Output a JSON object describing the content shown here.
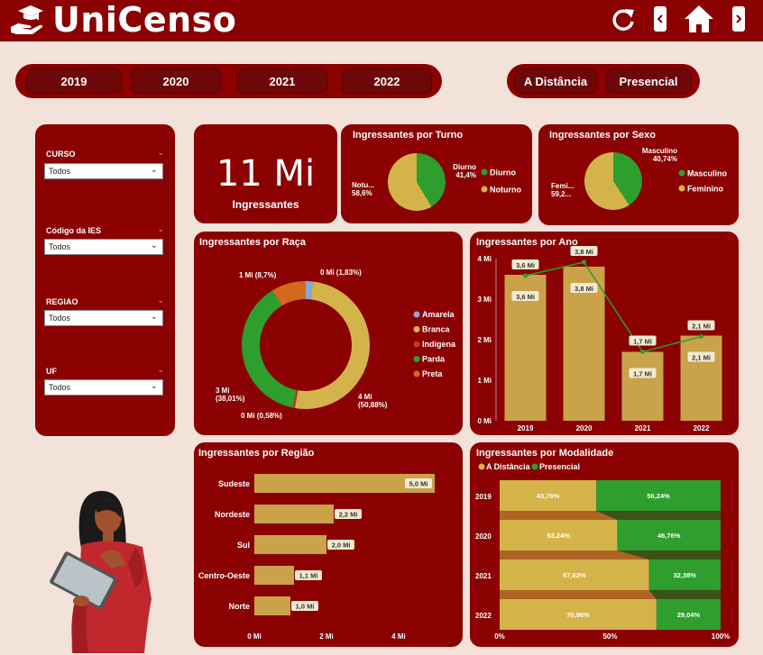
{
  "app": {
    "title": "UniCenso"
  },
  "header": {
    "refresh_icon": "refresh-icon",
    "back_icon": "chevron-left-icon",
    "home_icon": "home-icon",
    "next_icon": "chevron-right-icon"
  },
  "years": [
    "2019",
    "2020",
    "2021",
    "2022"
  ],
  "modalities": [
    "A Distância",
    "Presencial"
  ],
  "filters": [
    {
      "label": "CURSO",
      "value": "Todos"
    },
    {
      "label": "Código da IES",
      "value": "Todos"
    },
    {
      "label": "REGIAO",
      "value": "Todos"
    },
    {
      "label": "UF",
      "value": "Todos"
    }
  ],
  "kpi": {
    "value": "11 Mi",
    "label": "Ingressantes"
  },
  "colors": {
    "bg": "#f2e2da",
    "card": "#8b0000",
    "gold": "#d4b44a",
    "green": "#2e9e2e",
    "orange": "#d2691e",
    "blue": "#87a8d0",
    "red": "#c0392b"
  },
  "chart_data": [
    {
      "id": "turno",
      "type": "pie",
      "title": "Ingressantes por Turno",
      "slices": [
        {
          "name": "Diurno",
          "value": 41.4,
          "label": "Diurno\n41,4%",
          "color": "#2e9e2e"
        },
        {
          "name": "Noturno",
          "value": 58.6,
          "label": "Notu...\n58,6%",
          "color": "#d4b44a"
        }
      ],
      "legend": [
        "Diurno",
        "Noturno"
      ]
    },
    {
      "id": "sexo",
      "type": "pie",
      "title": "Ingressantes por Sexo",
      "slices": [
        {
          "name": "Masculino",
          "value": 40.74,
          "label": "Masculino\n40,74%",
          "color": "#2e9e2e"
        },
        {
          "name": "Feminino",
          "value": 59.26,
          "label": "Femi...\n59,2...",
          "color": "#d4b44a"
        }
      ],
      "legend": [
        "Masculino",
        "Feminino"
      ]
    },
    {
      "id": "raca",
      "type": "pie",
      "title": "Ingressantes por Raça",
      "slices": [
        {
          "name": "Amarela",
          "value": 1.83,
          "label": "0 Mi (1,83%)",
          "color": "#87a8d0"
        },
        {
          "name": "Branca",
          "value": 50.88,
          "label": "4 Mi\n(50,88%)",
          "color": "#d4b44a"
        },
        {
          "name": "Indigena",
          "value": 0.58,
          "label": "0 Mi (0,58%)",
          "color": "#c0392b"
        },
        {
          "name": "Parda",
          "value": 38.01,
          "label": "3 Mi\n(38,01%)",
          "color": "#2e9e2e"
        },
        {
          "name": "Preta",
          "value": 8.7,
          "label": "1 Mi (8,7%)",
          "color": "#d2691e"
        }
      ],
      "legend": [
        "Amarela",
        "Branca",
        "Indigena",
        "Parda",
        "Preta"
      ]
    },
    {
      "id": "ano",
      "type": "bar",
      "title": "Ingressantes por Ano",
      "categories": [
        "2019",
        "2020",
        "2021",
        "2022"
      ],
      "values": [
        3.6,
        3.8,
        1.7,
        2.1
      ],
      "value_labels": [
        "3,6 Mi",
        "3,8 Mi",
        "1,7 Mi",
        "2,1 Mi"
      ],
      "line_labels": [
        "3,6 Mi",
        "3,8 Mi",
        "1,7 Mi",
        "2,1 Mi"
      ],
      "yticks": [
        "0 Mi",
        "1 Mi",
        "2 Mi",
        "3 Mi",
        "4 Mi"
      ],
      "ylim": [
        0,
        4
      ]
    },
    {
      "id": "regiao",
      "type": "bar",
      "title": "Ingressantes por Região",
      "categories": [
        "Sudeste",
        "Nordeste",
        "Sul",
        "Centro-Oeste",
        "Norte"
      ],
      "values": [
        5.0,
        2.2,
        2.0,
        1.1,
        1.0
      ],
      "value_labels": [
        "5,0 Mi",
        "2,2 Mi",
        "2,0 Mi",
        "1,1 Mi",
        "1,0 Mi"
      ],
      "xticks": [
        "0 Mi",
        "2 Mi",
        "4 Mi"
      ],
      "xlim": [
        0,
        5.3
      ]
    },
    {
      "id": "modalidade",
      "type": "bar",
      "title": "Ingressantes por Modalidade",
      "categories": [
        "2019",
        "2020",
        "2021",
        "2022"
      ],
      "series": [
        {
          "name": "A Distância",
          "values": [
            43.76,
            53.24,
            67.62,
            70.96
          ],
          "labels": [
            "43,76%",
            "53,24%",
            "67,62%",
            "70,96%"
          ]
        },
        {
          "name": "Presencial",
          "values": [
            56.24,
            46.76,
            32.38,
            29.04
          ],
          "labels": [
            "56,24%",
            "46,76%",
            "32,38%",
            "29,04%"
          ]
        }
      ],
      "xticks": [
        "0%",
        "50%",
        "100%"
      ]
    }
  ]
}
